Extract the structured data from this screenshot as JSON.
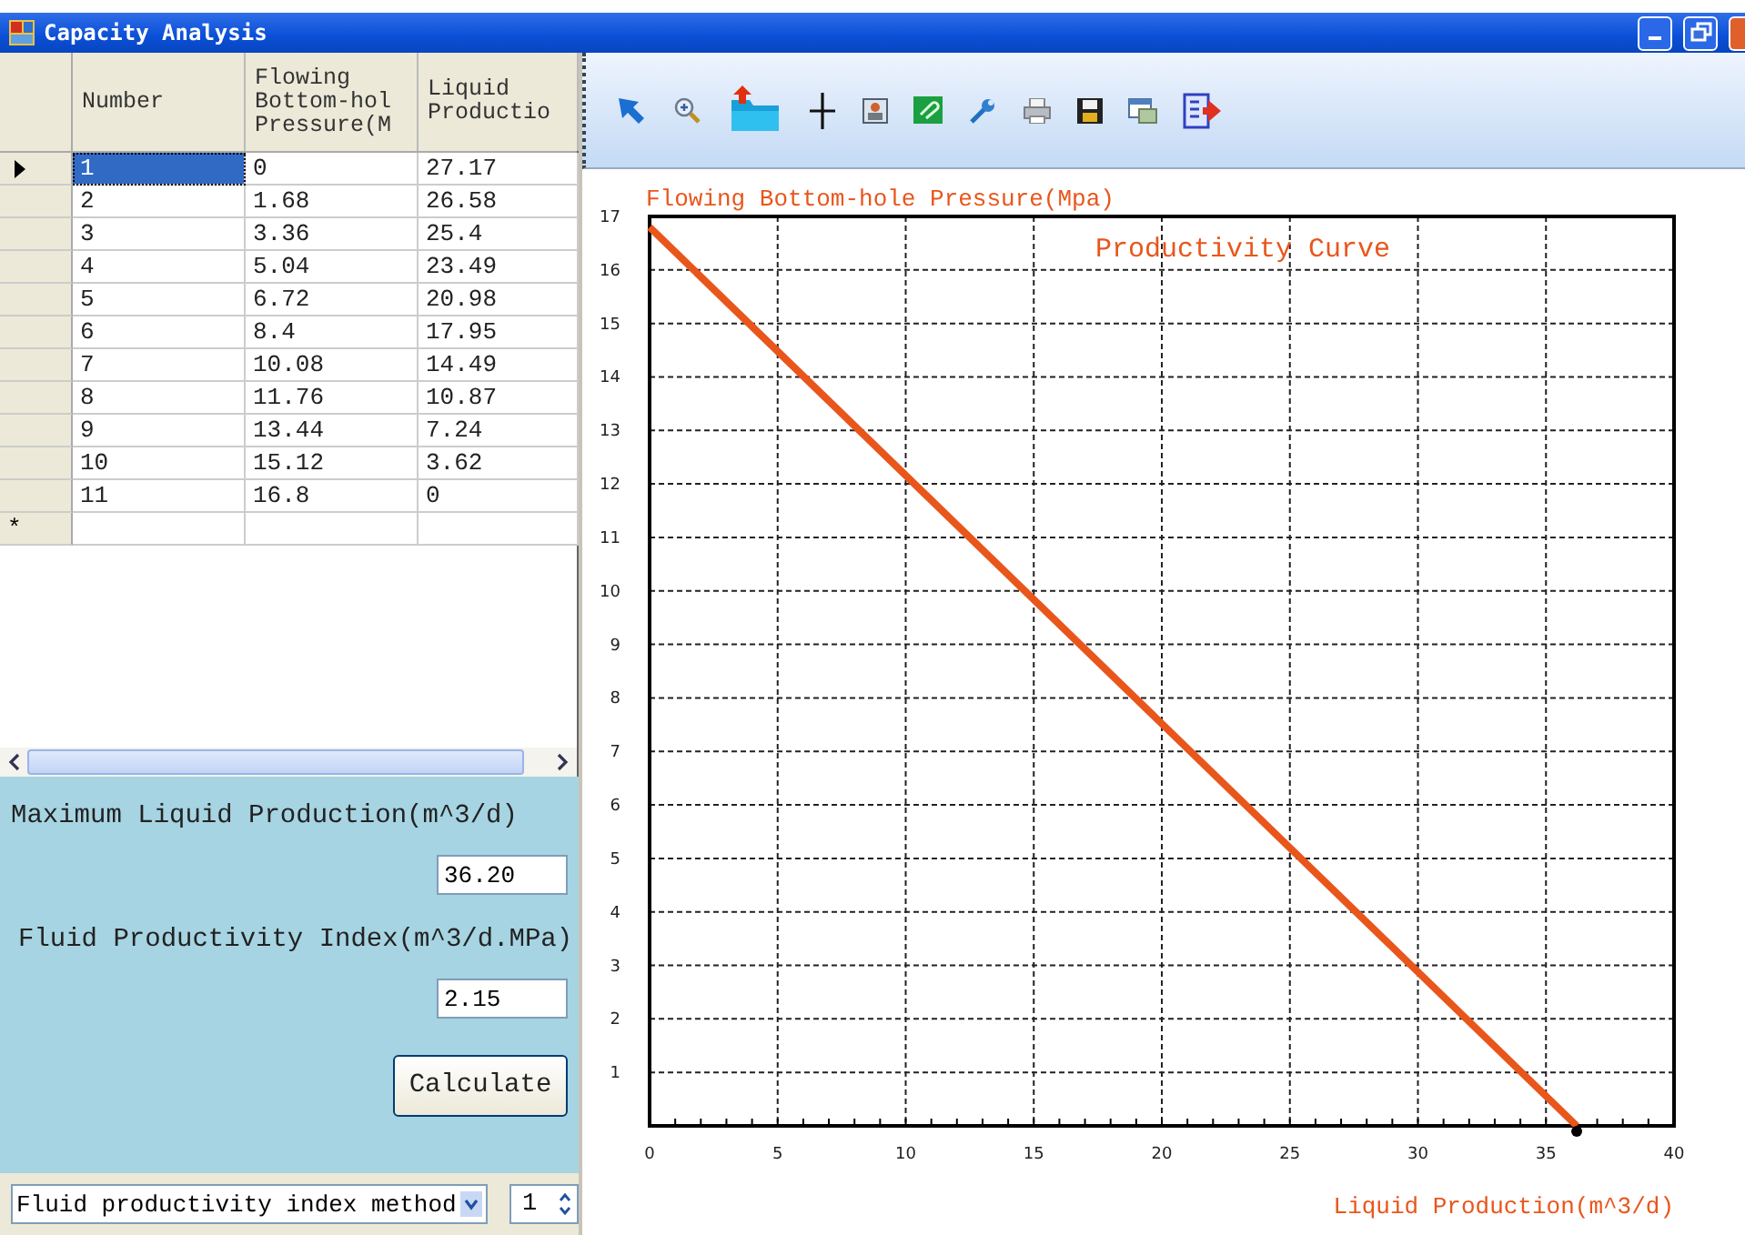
{
  "window": {
    "title": "Capacity Analysis"
  },
  "table": {
    "columns": [
      "Number",
      "Flowing Bottom-hol Pressure(M",
      "Liquid Productio"
    ],
    "rows": [
      {
        "cells": [
          "1",
          "0",
          "27.17"
        ],
        "selected": true
      },
      {
        "cells": [
          "2",
          "1.68",
          "26.58"
        ],
        "selected": false
      },
      {
        "cells": [
          "3",
          "3.36",
          "25.4"
        ],
        "selected": false
      },
      {
        "cells": [
          "4",
          "5.04",
          "23.49"
        ],
        "selected": false
      },
      {
        "cells": [
          "5",
          "6.72",
          "20.98"
        ],
        "selected": false
      },
      {
        "cells": [
          "6",
          "8.4",
          "17.95"
        ],
        "selected": false
      },
      {
        "cells": [
          "7",
          "10.08",
          "14.49"
        ],
        "selected": false
      },
      {
        "cells": [
          "8",
          "11.76",
          "10.87"
        ],
        "selected": false
      },
      {
        "cells": [
          "9",
          "13.44",
          "7.24"
        ],
        "selected": false
      },
      {
        "cells": [
          "10",
          "15.12",
          "3.62"
        ],
        "selected": false
      },
      {
        "cells": [
          "11",
          "16.8",
          "0"
        ],
        "selected": false
      }
    ],
    "new_row_marker": "*"
  },
  "results": {
    "max_production_label": "Maximum Liquid Production(m^3/d)",
    "max_production_value": "36.20",
    "index_label": "Fluid Productivity Index(m^3/d.MPa)",
    "index_value": "2.15"
  },
  "calculate_button": "Calculate",
  "method_dropdown": {
    "value": "Fluid productivity index method"
  },
  "count_spinner": {
    "value": "1"
  },
  "chart": {
    "chart_data": {
      "type": "line",
      "title": "Productivity Curve",
      "xlabel": "Liquid Production(m^3/d)",
      "ylabel": "Flowing Bottom-hole Pressure(Mpa)",
      "x": [
        0,
        36.2
      ],
      "series": [
        {
          "color": "#e8561c",
          "values": [
            16.8,
            0
          ]
        }
      ],
      "grid": true,
      "xlim": [
        0,
        40
      ],
      "ylim": [
        0,
        17
      ],
      "xticks": [
        0,
        5,
        10,
        15,
        20,
        25,
        30,
        35,
        40
      ],
      "yticks": [
        1,
        2,
        3,
        4,
        5,
        6,
        7,
        8,
        9,
        10,
        11,
        12,
        13,
        14,
        15,
        16,
        17
      ]
    }
  }
}
